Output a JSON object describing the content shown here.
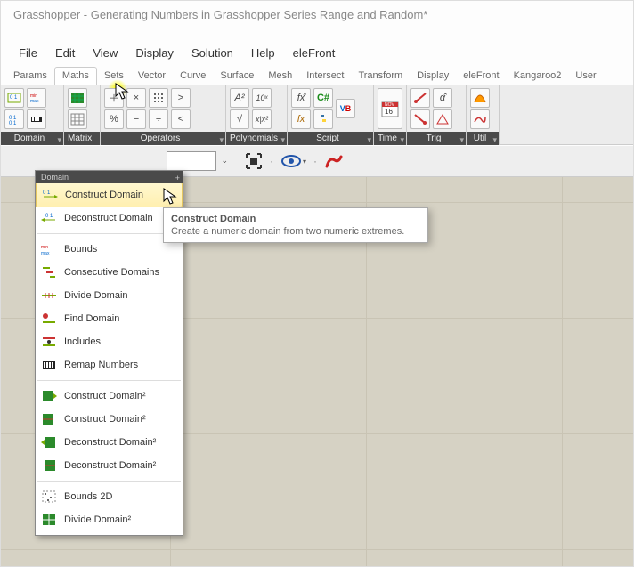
{
  "title": "Grasshopper - Generating Numbers in Grasshopper Series Range and Random*",
  "menu": [
    "File",
    "Edit",
    "View",
    "Display",
    "Solution",
    "Help",
    "eleFront"
  ],
  "tabs": [
    "Params",
    "Maths",
    "Sets",
    "Vector",
    "Curve",
    "Surface",
    "Mesh",
    "Intersect",
    "Transform",
    "Display",
    "eleFront",
    "Kangaroo2",
    "User"
  ],
  "active_tab": "Maths",
  "ribbon": {
    "groups": [
      {
        "label": "Domain"
      },
      {
        "label": "Matrix"
      },
      {
        "label": "Operators"
      },
      {
        "label": "Polynomials"
      },
      {
        "label": "Script"
      },
      {
        "label": "Time"
      },
      {
        "label": "Trig"
      },
      {
        "label": "Util"
      }
    ]
  },
  "toolbar2": {
    "zoom": "",
    "eye": "eye",
    "paint": "paint"
  },
  "dropdown": {
    "header": "Domain",
    "hover_index": 0,
    "groups": [
      [
        "Construct Domain",
        "Deconstruct Domain"
      ],
      [
        "Bounds",
        "Consecutive Domains",
        "Divide Domain",
        "Find Domain",
        "Includes",
        "Remap Numbers"
      ],
      [
        "Construct Domain²",
        "Construct Domain²",
        "Deconstruct Domain²",
        "Deconstruct Domain²"
      ],
      [
        "Bounds 2D",
        "Divide Domain²"
      ]
    ]
  },
  "tooltip": {
    "title": "Construct Domain",
    "body": "Create a numeric domain from two numeric extremes."
  }
}
